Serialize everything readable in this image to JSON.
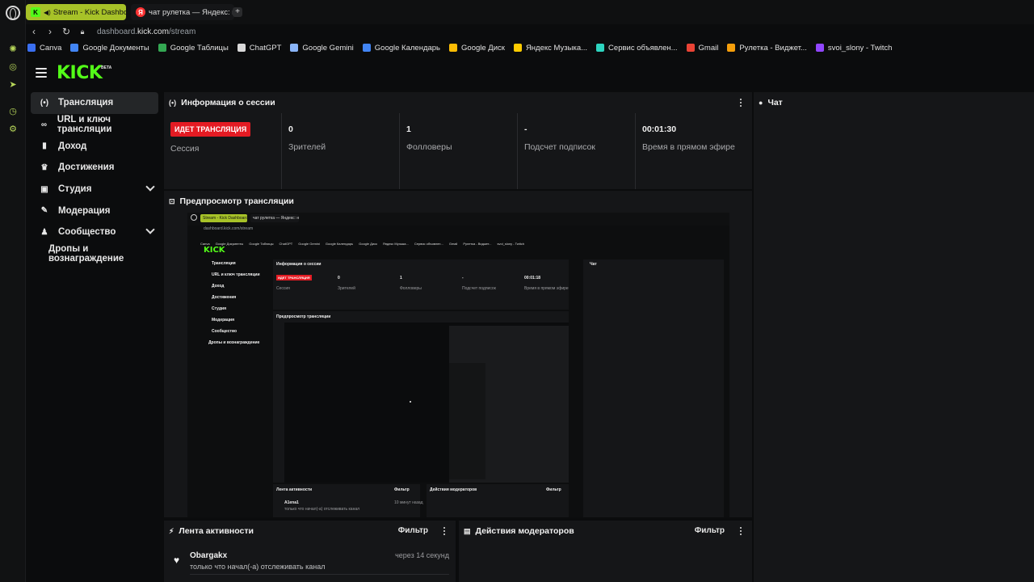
{
  "browser": {
    "tabs": [
      {
        "label": "Stream - Kick Dashboard",
        "active": true
      },
      {
        "label": "чат рулетка — Яндекс: на",
        "active": false
      }
    ],
    "new_tab_label": "+",
    "url_host": "dashboard.",
    "url_domain": "kick.com",
    "url_path": "/stream",
    "bookmarks": [
      {
        "label": "Canva",
        "color": "#3a6ff0"
      },
      {
        "label": "Google Документы",
        "color": "#4285f4"
      },
      {
        "label": "Google Таблицы",
        "color": "#34a853"
      },
      {
        "label": "ChatGPT",
        "color": "#d9d9d9"
      },
      {
        "label": "Google Gemini",
        "color": "#8ab4f8"
      },
      {
        "label": "Google Календарь",
        "color": "#4285f4"
      },
      {
        "label": "Google Диск",
        "color": "#fbbc04"
      },
      {
        "label": "Яндекс Музыка...",
        "color": "#ffcc00"
      },
      {
        "label": "Сервис объявлен...",
        "color": "#2dd4bf"
      },
      {
        "label": "Gmail",
        "color": "#ea4335"
      },
      {
        "label": "Рулетка - Виджет...",
        "color": "#f59e0b"
      },
      {
        "label": "svoi_slony - Twitch",
        "color": "#9146ff"
      }
    ]
  },
  "header": {
    "logo": "KICK",
    "logo_badge": "BETA"
  },
  "nav": {
    "items": [
      {
        "label": "Трансляция",
        "icon": "broadcast-icon",
        "glyph": "(•)",
        "active": true
      },
      {
        "label": "URL и ключ трансляции",
        "icon": "link-icon",
        "glyph": "∞"
      },
      {
        "label": "Доход",
        "icon": "chart-icon",
        "glyph": "▮"
      },
      {
        "label": "Достижения",
        "icon": "trophy-icon",
        "glyph": "♛"
      },
      {
        "label": "Студия",
        "icon": "studio-icon",
        "glyph": "▣",
        "expandable": true
      },
      {
        "label": "Модерация",
        "icon": "wrench-icon",
        "glyph": "✎"
      },
      {
        "label": "Сообщество",
        "icon": "community-icon",
        "glyph": "♟",
        "expandable": true
      },
      {
        "label": "Дропы и вознаграждение",
        "sub": true
      }
    ]
  },
  "session": {
    "title": "Информация о сессии",
    "live_badge": "ИДЕТ ТРАНСЛЯЦИЯ",
    "session_label": "Сессия",
    "stats": [
      {
        "value": "0",
        "label": "Зрителей"
      },
      {
        "value": "1",
        "label": "Фолловеры"
      },
      {
        "value": "-",
        "label": "Подсчет подписок"
      },
      {
        "value": "00:01:30",
        "label": "Время в прямом эфире"
      }
    ]
  },
  "preview": {
    "title": "Предпросмотр трансляции",
    "mini_timer": "00:01:18",
    "mini_feed_name": "A1ena1",
    "mini_feed_time": "10 минут назад",
    "mini_feed_desc": "только что начал(-а) отслеживать канал"
  },
  "chat": {
    "title": "Чат"
  },
  "activity": {
    "title": "Лента активности",
    "filter": "Фильтр",
    "items": [
      {
        "name": "Obargakx",
        "time": "через 14 секунд",
        "desc": "только что начал(-а) отслеживать канал"
      },
      {
        "name": "...",
        "time": "",
        "desc": ""
      }
    ]
  },
  "moderators": {
    "title": "Действия модераторов",
    "filter": "Фильтр"
  },
  "colors": {
    "accent": "#53fc18",
    "tab_active": "#a7c228",
    "live": "#e41b23",
    "panel": "#151618",
    "background": "#0b0c0d"
  }
}
